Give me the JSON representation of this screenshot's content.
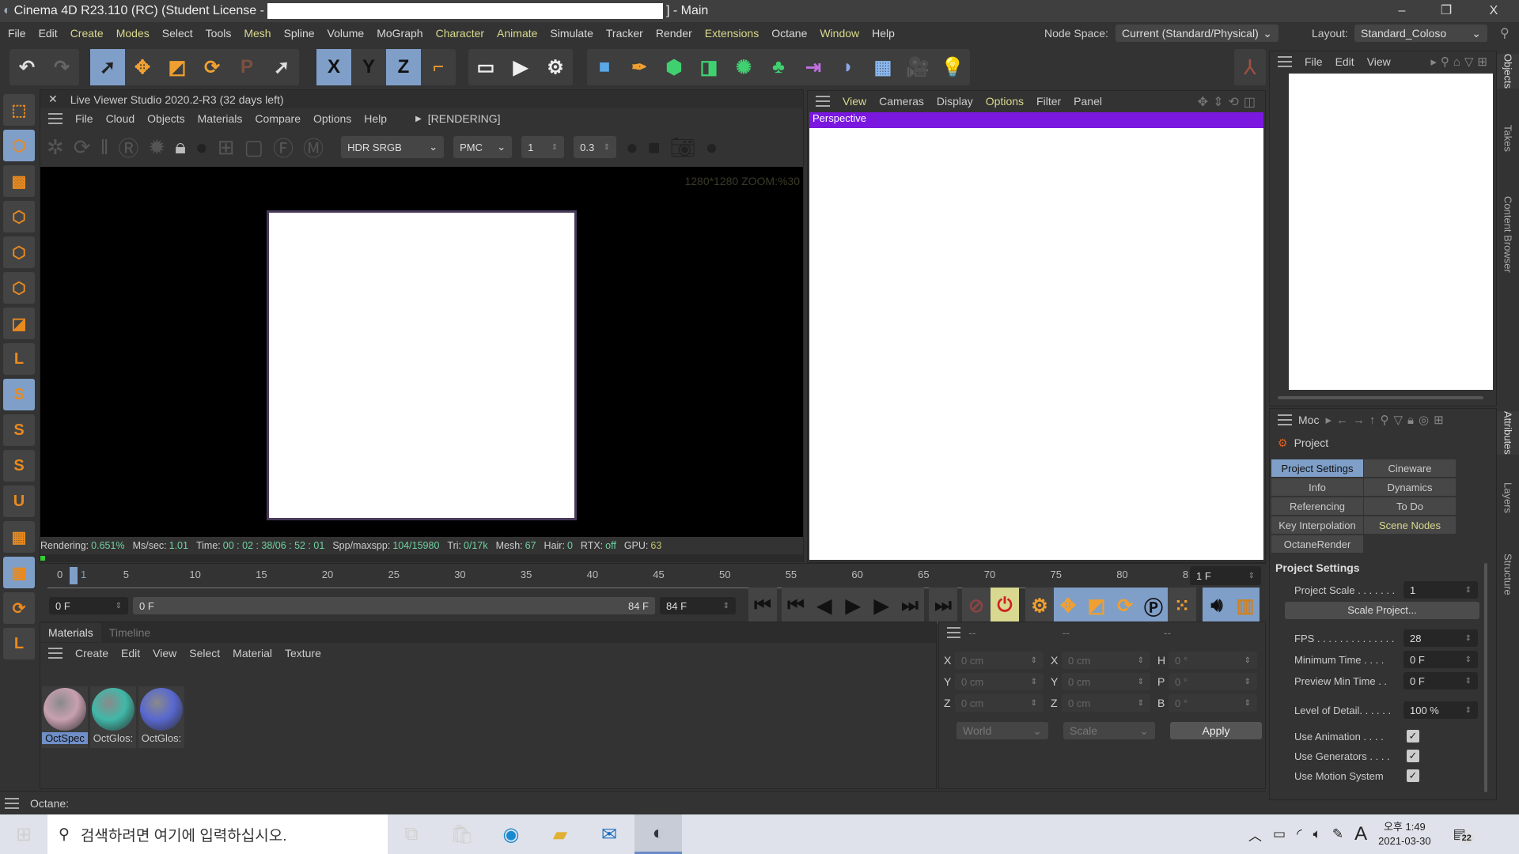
{
  "window": {
    "title": "Cinema 4D R23.110 (RC) (Student License - ",
    "title_suffix": "] - Main",
    "minimize": "–",
    "restore": "❐",
    "close": "X"
  },
  "menu": {
    "items": [
      {
        "label": "File",
        "y": false
      },
      {
        "label": "Edit",
        "y": false
      },
      {
        "label": "Create",
        "y": true
      },
      {
        "label": "Modes",
        "y": true
      },
      {
        "label": "Select",
        "y": false
      },
      {
        "label": "Tools",
        "y": false
      },
      {
        "label": "Mesh",
        "y": true
      },
      {
        "label": "Spline",
        "y": false
      },
      {
        "label": "Volume",
        "y": false
      },
      {
        "label": "MoGraph",
        "y": false
      },
      {
        "label": "Character",
        "y": true
      },
      {
        "label": "Animate",
        "y": true
      },
      {
        "label": "Simulate",
        "y": false
      },
      {
        "label": "Tracker",
        "y": false
      },
      {
        "label": "Render",
        "y": false
      },
      {
        "label": "Extensions",
        "y": true
      },
      {
        "label": "Octane",
        "y": false
      },
      {
        "label": "Window",
        "y": true
      },
      {
        "label": "Help",
        "y": false
      }
    ],
    "node_space_label": "Node Space:",
    "node_space_value": "Current (Standard/Physical)",
    "layout_label": "Layout:",
    "layout_value": "Standard_Coloso"
  },
  "toolbar": {
    "groups": [
      [
        {
          "icon": "undo-icon",
          "g": "↶",
          "c": "#ddd"
        },
        {
          "icon": "redo-icon",
          "g": "↷",
          "c": "#666"
        }
      ],
      [
        {
          "icon": "select-arrow-icon",
          "g": "➚",
          "c": "#222",
          "sel": true
        },
        {
          "icon": "move-icon",
          "g": "✥",
          "c": "#f0a030"
        },
        {
          "icon": "scale-icon",
          "g": "◩",
          "c": "#f0a030"
        },
        {
          "icon": "rotate-icon",
          "g": "⟳",
          "c": "#f0a030"
        },
        {
          "icon": "psr-icon",
          "g": "P",
          "c": "#7a5040"
        },
        {
          "icon": "live-select-icon",
          "g": "➚",
          "c": "#ddd"
        }
      ],
      [
        {
          "icon": "x-axis-icon",
          "g": "X",
          "c": "#111",
          "sel": true
        },
        {
          "icon": "y-axis-icon",
          "g": "Y",
          "c": "#111"
        },
        {
          "icon": "z-axis-icon",
          "g": "Z",
          "c": "#111",
          "sel": true
        },
        {
          "icon": "coordinate-system-icon",
          "g": "⌐",
          "c": "#f0a030"
        }
      ],
      [
        {
          "icon": "render-view-icon",
          "g": "▭",
          "c": "#eee"
        },
        {
          "icon": "render-picture-viewer-icon",
          "g": "▶",
          "c": "#eee"
        },
        {
          "icon": "render-settings-icon",
          "g": "⚙",
          "c": "#eee"
        }
      ],
      [
        {
          "icon": "cube-icon",
          "g": "■",
          "c": "#5aa8e8"
        },
        {
          "icon": "pen-icon",
          "g": "✒",
          "c": "#f0a030"
        },
        {
          "icon": "subdivision-icon",
          "g": "⬢",
          "c": "#40d070"
        },
        {
          "icon": "extrude-icon",
          "g": "◨",
          "c": "#40d070"
        },
        {
          "icon": "cloner-icon",
          "g": "✺",
          "c": "#40d070"
        },
        {
          "icon": "mograph-icon",
          "g": "♣",
          "c": "#40d070"
        },
        {
          "icon": "deformer-icon",
          "g": "⇥",
          "c": "#c070e0"
        },
        {
          "icon": "field-icon",
          "g": "◗",
          "c": "#8aa8e8"
        },
        {
          "icon": "floor-icon",
          "g": "▦",
          "c": "#8ab8f0"
        },
        {
          "icon": "camera-icon",
          "g": "🎥",
          "c": "#ddd"
        },
        {
          "icon": "light-icon",
          "g": "💡",
          "c": "#eee"
        }
      ]
    ]
  },
  "left_tools": [
    {
      "icon": "make-editable-icon",
      "g": "⬚"
    },
    {
      "icon": "model-mode-icon",
      "g": "⬡",
      "sel": true
    },
    {
      "icon": "texture-mode-icon",
      "g": "▩"
    },
    {
      "icon": "points-mode-icon",
      "g": "⬡"
    },
    {
      "icon": "edges-mode-icon",
      "g": "⬡"
    },
    {
      "icon": "polygons-mode-icon",
      "g": "⬡"
    },
    {
      "icon": "uv-mode-icon",
      "g": "◪"
    },
    {
      "icon": "axis-mode-icon",
      "g": "L"
    },
    {
      "icon": "snap-s-icon",
      "g": "S",
      "sel": true
    },
    {
      "icon": "snap-settings-icon",
      "g": "S"
    },
    {
      "icon": "solo-icon",
      "g": "S"
    },
    {
      "icon": "magnet-icon",
      "g": "U"
    },
    {
      "icon": "workplane-icon",
      "g": "▦"
    },
    {
      "icon": "workplane-lock-icon",
      "g": "▦",
      "sel": true
    },
    {
      "icon": "workplane-align-icon",
      "g": "⟳"
    },
    {
      "icon": "axis-align-icon",
      "g": "L"
    }
  ],
  "live_viewer": {
    "title": "Live Viewer Studio 2020.2-R3 (32 days left)",
    "menu": [
      "File",
      "Cloud",
      "Objects",
      "Materials",
      "Compare",
      "Options",
      "Help"
    ],
    "state": "[RENDERING]",
    "tonemap": "HDR SRGB",
    "kernel": "PMC",
    "value1": "1",
    "value2": "0.3",
    "overlay": "1280*1280 ZOOM:%30",
    "status": [
      {
        "k": "Rendering:",
        "v": "0.651%"
      },
      {
        "k": "Ms/sec:",
        "v": "1.01"
      },
      {
        "k": "Time:",
        "v": "00 : 02 : 38/06 : 52 : 01"
      },
      {
        "k": "Spp/maxspp:",
        "v": "104/15980"
      },
      {
        "k": "Tri:",
        "v": "0/17k"
      },
      {
        "k": "Mesh:",
        "v": "67"
      },
      {
        "k": "Hair:",
        "v": "0"
      },
      {
        "k": "RTX:",
        "v": "off"
      },
      {
        "k": "GPU:",
        "v": "63"
      }
    ],
    "progress": 0.00651
  },
  "viewport": {
    "menu": [
      {
        "label": "View",
        "y": true
      },
      {
        "label": "Cameras",
        "y": false
      },
      {
        "label": "Display",
        "y": false
      },
      {
        "label": "Options",
        "y": true
      },
      {
        "label": "Filter",
        "y": false
      },
      {
        "label": "Panel",
        "y": false
      }
    ],
    "camera": "Perspective"
  },
  "objects": {
    "menu": [
      "File",
      "Edit",
      "View"
    ]
  },
  "side_tabs_top": [
    "Objects",
    "Takes",
    "Content Browser"
  ],
  "side_tabs_bottom": [
    "Attributes",
    "Layers",
    "Structure"
  ],
  "timeline": {
    "ticks": [
      "0",
      "5",
      "10",
      "15",
      "20",
      "25",
      "30",
      "35",
      "40",
      "45",
      "50",
      "55",
      "60",
      "65",
      "70",
      "75",
      "80",
      "8"
    ],
    "current": "1",
    "current_field": "1 F",
    "start": "0 F",
    "range_start": "0 F",
    "range_end": "84 F",
    "end": "84 F"
  },
  "materials": {
    "tabs": [
      "Materials",
      "Timeline"
    ],
    "menu": [
      "Create",
      "Edit",
      "View",
      "Select",
      "Material",
      "Texture"
    ],
    "items": [
      {
        "name": "OctSpec",
        "color": "#c8a0b0"
      },
      {
        "name": "OctGlos:",
        "color": "#40b8a8"
      },
      {
        "name": "OctGlos:",
        "color": "#5868d0"
      }
    ]
  },
  "coords": {
    "headers": [
      "--",
      "--",
      "--"
    ],
    "rows": [
      [
        "X",
        "0 cm",
        "X",
        "0 cm",
        "H",
        "0 °"
      ],
      [
        "Y",
        "0 cm",
        "Y",
        "0 cm",
        "P",
        "0 °"
      ],
      [
        "Z",
        "0 cm",
        "Z",
        "0 cm",
        "B",
        "0 °"
      ]
    ],
    "mode": "World",
    "type": "Scale",
    "apply": "Apply"
  },
  "attributes": {
    "mode": "Moc",
    "object": "Project",
    "tabs": [
      {
        "label": "Project Settings",
        "sel": true
      },
      {
        "label": "Cineware"
      },
      {
        "label": "Info"
      },
      {
        "label": "Dynamics"
      },
      {
        "label": "Referencing"
      },
      {
        "label": "To Do"
      },
      {
        "label": "Key Interpolation"
      },
      {
        "label": "Scene Nodes",
        "y": true
      },
      {
        "label": "OctaneRender"
      }
    ],
    "section": "Project Settings",
    "project_scale_label": "Project Scale . . . . . . .",
    "project_scale": "1",
    "scale_project": "Scale Project...",
    "fps_label": "FPS . . . . . . . . . . . . . .",
    "fps": "28",
    "min_time_label": "Minimum Time . . . .",
    "min_time": "0 F",
    "preview_min_label": "Preview Min Time . .",
    "preview_min": "0 F",
    "lod_label": "Level of Detail. . . . . .",
    "lod": "100 %",
    "checks": [
      {
        "label": "Use Animation . . . .",
        "checked": true
      },
      {
        "label": "Use Generators . . . .",
        "checked": true
      },
      {
        "label": "Use Motion System",
        "checked": true
      }
    ]
  },
  "statusbar": {
    "text": "Octane:"
  },
  "taskbar": {
    "search_placeholder": "검색하려면 여기에 입력하십시오.",
    "time": "오후 1:49",
    "date": "2021-03-30",
    "ime": "A",
    "notifications": "22"
  }
}
